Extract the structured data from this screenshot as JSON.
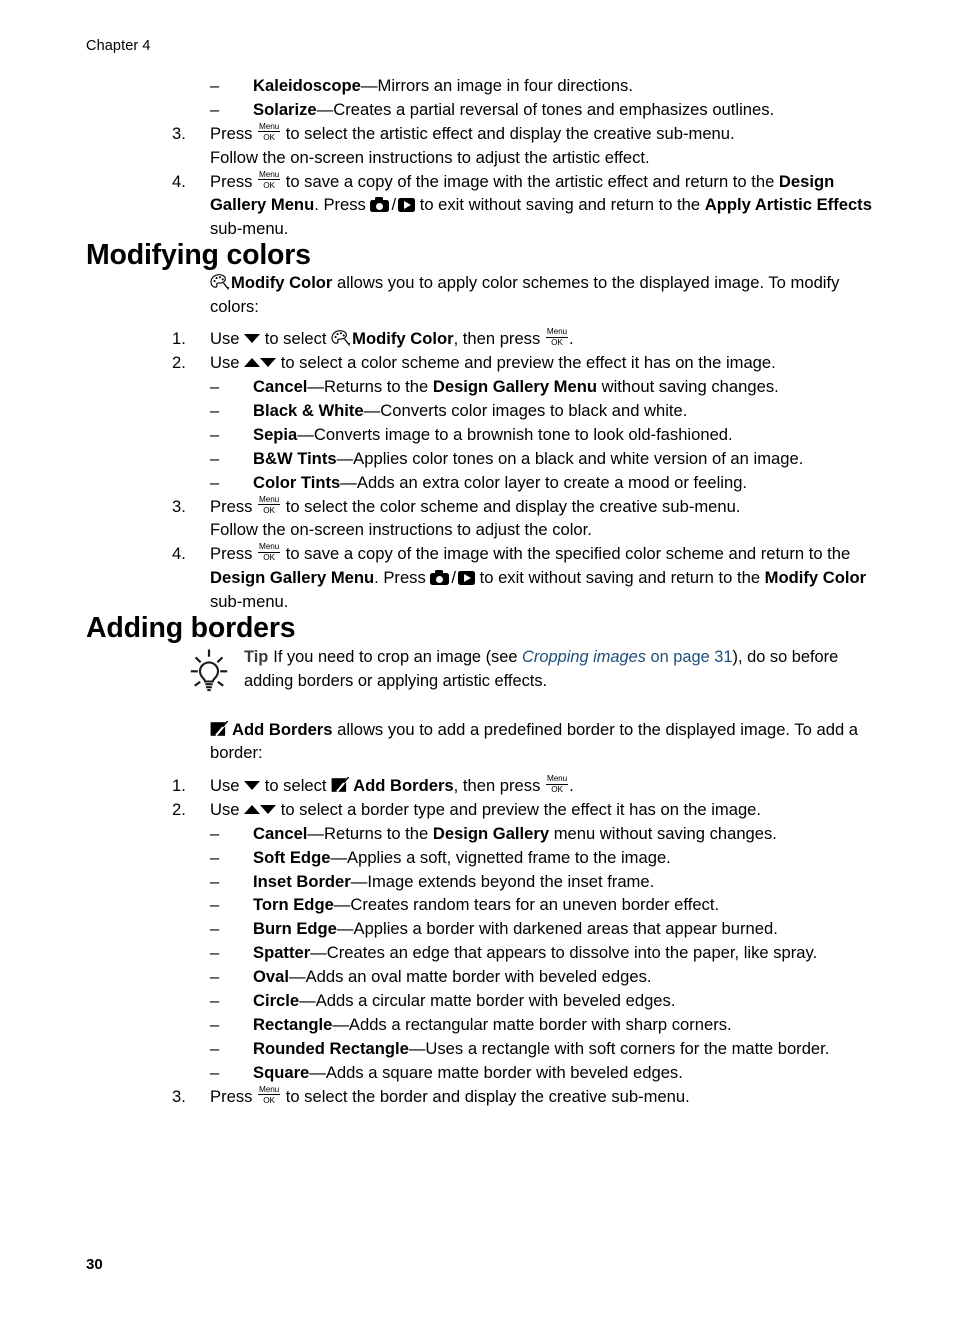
{
  "header": {
    "chapter": "Chapter 4"
  },
  "footer": {
    "page_number": "30"
  },
  "icons": {
    "menu_ok_top": "Menu",
    "menu_ok_bottom": "OK",
    "palette": "palette-icon",
    "camera": "camera-icon",
    "playback": "playback-icon",
    "add_borders": "add-borders-icon",
    "lightbulb": "lightbulb-icon",
    "arrow_down": "arrow-down-icon",
    "arrow_up": "arrow-up-icon"
  },
  "colors": {
    "text": "#000000",
    "link": "#1F4E79",
    "tip_label": "#3B3B3B"
  },
  "artistic_effects": {
    "bullets": [
      {
        "term": "Kaleidoscope",
        "desc": "—Mirrors an image in four directions."
      },
      {
        "term": "Solarize",
        "desc": "—Creates a partial reversal of tones and emphasizes outlines."
      }
    ],
    "step3": {
      "num": "3.",
      "pre": "Press ",
      "post": " to select the artistic effect and display the creative sub-menu.",
      "line2": "Follow the on-screen instructions to adjust the artistic effect."
    },
    "step4": {
      "num": "4.",
      "p1": "Press ",
      "p2": " to save a copy of the image with the artistic effect and return to the ",
      "b1": "Design Gallery Menu",
      "p3": ". Press ",
      "p4": " to exit without saving and return to the ",
      "b2": "Apply Artistic Effects",
      "p5": " sub-menu."
    }
  },
  "modifying_colors": {
    "title": "Modifying colors",
    "intro": {
      "bold": "Modify Color",
      "text": " allows you to apply color schemes to the displayed image. To modify colors:"
    },
    "step1": {
      "num": "1.",
      "p1": "Use ",
      "p2": " to select ",
      "b1": "Modify Color",
      "p3": ", then press ",
      "p4": "."
    },
    "step2": {
      "num": "2.",
      "p1": "Use ",
      "p2": " to select a color scheme and preview the effect it has on the image."
    },
    "bullets": [
      {
        "term": "Cancel",
        "desc_pre": "—Returns to the ",
        "desc_bold": "Design Gallery Menu",
        "desc_post": " without saving changes."
      },
      {
        "term": "Black & White",
        "desc_pre": "—Converts color images to black and white.",
        "desc_bold": "",
        "desc_post": ""
      },
      {
        "term": "Sepia",
        "desc_pre": "—Converts image to a brownish tone to look old-fashioned.",
        "desc_bold": "",
        "desc_post": ""
      },
      {
        "term": "B&W Tints",
        "desc_pre": "—Applies color tones on a black and white version of an image.",
        "desc_bold": "",
        "desc_post": ""
      },
      {
        "term": "Color Tints",
        "desc_pre": "—Adds an extra color layer to create a mood or feeling.",
        "desc_bold": "",
        "desc_post": ""
      }
    ],
    "step3": {
      "num": "3.",
      "pre": "Press ",
      "post": " to select the color scheme and display the creative sub-menu.",
      "line2": "Follow the on-screen instructions to adjust the color."
    },
    "step4": {
      "num": "4.",
      "p1": "Press ",
      "p2": " to save a copy of the image with the specified color scheme and return to the ",
      "b1": "Design Gallery Menu",
      "p3": ". Press ",
      "p4": " to exit without saving and return to the ",
      "b2": "Modify Color",
      "p5": " sub-menu."
    }
  },
  "adding_borders": {
    "title": "Adding borders",
    "tip": {
      "label": "Tip",
      "pre": "If you need to crop an image (see ",
      "xref_italic": "Cropping images",
      "xref_plain": " on page 31",
      "post": "), do so before adding borders or applying artistic effects."
    },
    "intro": {
      "bold": "Add Borders",
      "text": " allows you to add a predefined border to the displayed image. To add a border:"
    },
    "step1": {
      "num": "1.",
      "p1": "Use ",
      "p2": " to select ",
      "b1": "Add Borders",
      "p3": ", then press ",
      "p4": "."
    },
    "step2": {
      "num": "2.",
      "p1": "Use ",
      "p2": " to select a border type and preview the effect it has on the image."
    },
    "bullets": [
      {
        "term": "Cancel",
        "desc_pre": "—Returns to the ",
        "desc_bold": "Design Gallery",
        "desc_post": " menu without saving changes."
      },
      {
        "term": "Soft Edge",
        "desc_pre": "—Applies a soft, vignetted frame to the image.",
        "desc_bold": "",
        "desc_post": ""
      },
      {
        "term": "Inset Border",
        "desc_pre": "—Image extends beyond the inset frame.",
        "desc_bold": "",
        "desc_post": ""
      },
      {
        "term": "Torn Edge",
        "desc_pre": "—Creates random tears for an uneven border effect.",
        "desc_bold": "",
        "desc_post": ""
      },
      {
        "term": "Burn Edge",
        "desc_pre": "—Applies a border with darkened areas that appear burned.",
        "desc_bold": "",
        "desc_post": ""
      },
      {
        "term": "Spatter",
        "desc_pre": "—Creates an edge that appears to dissolve into the paper, like spray.",
        "desc_bold": "",
        "desc_post": ""
      },
      {
        "term": "Oval",
        "desc_pre": "—Adds an oval matte border with beveled edges.",
        "desc_bold": "",
        "desc_post": ""
      },
      {
        "term": "Circle",
        "desc_pre": "—Adds a circular matte border with beveled edges.",
        "desc_bold": "",
        "desc_post": ""
      },
      {
        "term": "Rectangle",
        "desc_pre": "—Adds a rectangular matte border with sharp corners.",
        "desc_bold": "",
        "desc_post": ""
      },
      {
        "term": "Rounded Rectangle",
        "desc_pre": "—Uses a rectangle with soft corners for the matte border.",
        "desc_bold": "",
        "desc_post": ""
      },
      {
        "term": "Square",
        "desc_pre": "—Adds a square matte border with beveled edges.",
        "desc_bold": "",
        "desc_post": ""
      }
    ],
    "step3": {
      "num": "3.",
      "pre": "Press ",
      "post": " to select the border and display the creative sub-menu."
    }
  }
}
